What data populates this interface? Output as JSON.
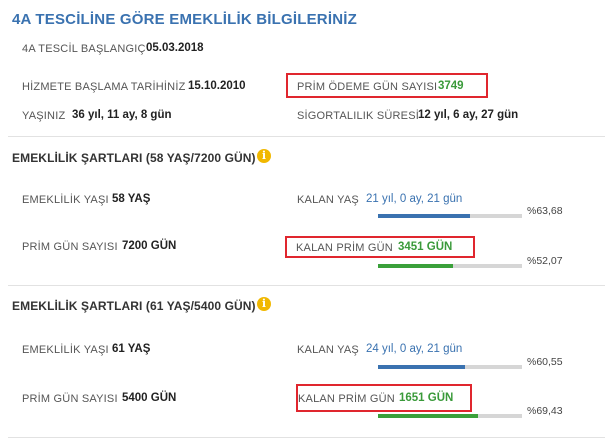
{
  "page_title": "4A TESCİLİNE GÖRE EMEKLİLİK BİLGİLERİNİZ",
  "tescil": {
    "start_label": "4A TESCİL BAŞLANGIÇ",
    "start_value": "05.03.2018",
    "service_label": "HİZMETE BAŞLAMA TARİHİNİZ",
    "service_value": "15.10.2010",
    "prim_label": "PRİM ÖDEME GÜN SAYISI",
    "prim_value": "3749",
    "age_label": "YAŞINIZ",
    "age_value": "36 yıl, 11 ay, 8 gün",
    "insured_label": "SİGORTALILIK SÜRESİ",
    "insured_value": "12 yıl, 6 ay, 27 gün"
  },
  "sections": [
    {
      "title": "EMEKLİLİK ŞARTLARI (58 YAŞ/7200 GÜN)",
      "age_label": "EMEKLİLİK YAŞI",
      "age_value": "58 YAŞ",
      "rem_age_label": "KALAN YAŞ",
      "rem_age_value": "21 yıl, 0 ay, 21 gün",
      "rem_age_pct": "%63,68",
      "rem_age_fraction": 0.6368,
      "prim_label": "PRİM GÜN SAYISI",
      "prim_value": "7200 GÜN",
      "rem_prim_label": "KALAN PRİM GÜN",
      "rem_prim_value": "3451 GÜN",
      "rem_prim_pct": "%52,07",
      "rem_prim_fraction": 0.5207
    },
    {
      "title": "EMEKLİLİK ŞARTLARI (61 YAŞ/5400 GÜN)",
      "age_label": "EMEKLİLİK YAŞI",
      "age_value": "61 YAŞ",
      "rem_age_label": "KALAN YAŞ",
      "rem_age_value": "24 yıl, 0 ay, 21 gün",
      "rem_age_pct": "%60,55",
      "rem_age_fraction": 0.6055,
      "prim_label": "PRİM GÜN SAYISI",
      "prim_value": "5400 GÜN",
      "rem_prim_label": "KALAN PRİM GÜN",
      "rem_prim_value": "1651 GÜN",
      "rem_prim_pct": "%69,43",
      "rem_prim_fraction": 0.6943
    }
  ],
  "icons": {
    "info": "info-icon"
  },
  "colors": {
    "title": "#3a72b0",
    "age_bar": "#3a72b0",
    "prim_bar": "#3aa03a",
    "highlight": "#e0262e",
    "info": "#f1b800"
  }
}
